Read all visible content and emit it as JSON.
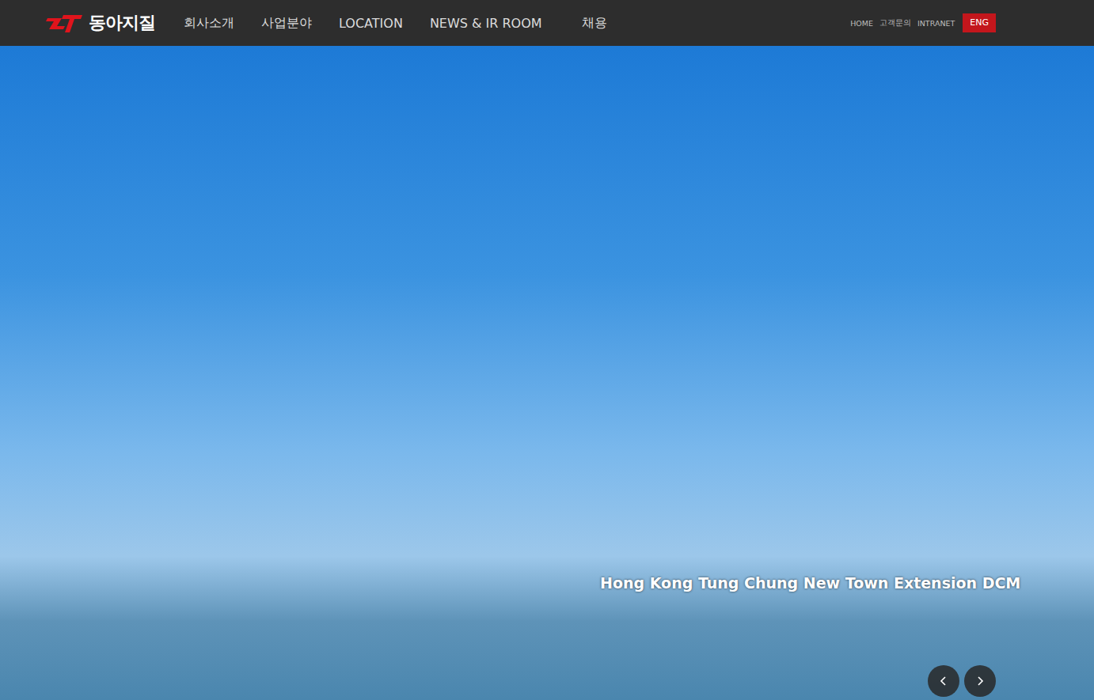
{
  "header": {
    "logo": "동아지질",
    "menu": [
      "회사소개",
      "사업분야",
      "LOCATION",
      "NEWS & IR ROOM",
      "채용"
    ],
    "utility": [
      "HOME",
      "고객문의",
      "INTRANET"
    ],
    "language": "ENG"
  },
  "hero": {
    "caption": "Hong Kong Tung Chung New Town Extension DCM"
  }
}
